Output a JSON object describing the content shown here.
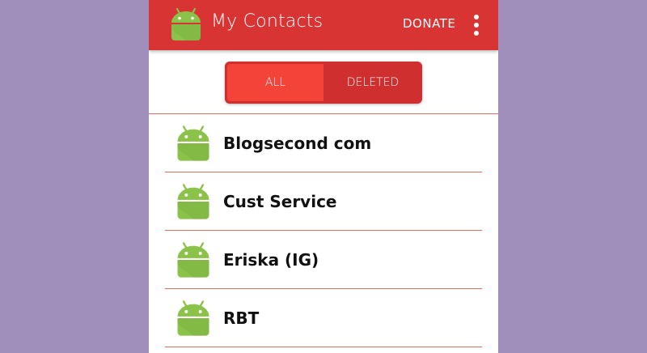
{
  "colors": {
    "background": "#a08fbb",
    "app_bar": "#d83434",
    "selected_tab": "#f4443a",
    "divider": "#e06a6a",
    "android_green": "#8bc34a"
  },
  "app_bar": {
    "icon": "android-icon",
    "title": "My Contacts",
    "donate_label": "DONATE",
    "overflow_icon": "more-vert-icon"
  },
  "tabs": [
    {
      "label": "ALL",
      "selected": true
    },
    {
      "label": "DELETED",
      "selected": false
    }
  ],
  "contacts": [
    {
      "name": "Blogsecond com",
      "avatar": "android-icon"
    },
    {
      "name": "Cust Service",
      "avatar": "android-icon"
    },
    {
      "name": "Eriska (IG)",
      "avatar": "android-icon"
    },
    {
      "name": "RBT",
      "avatar": "android-icon"
    }
  ]
}
